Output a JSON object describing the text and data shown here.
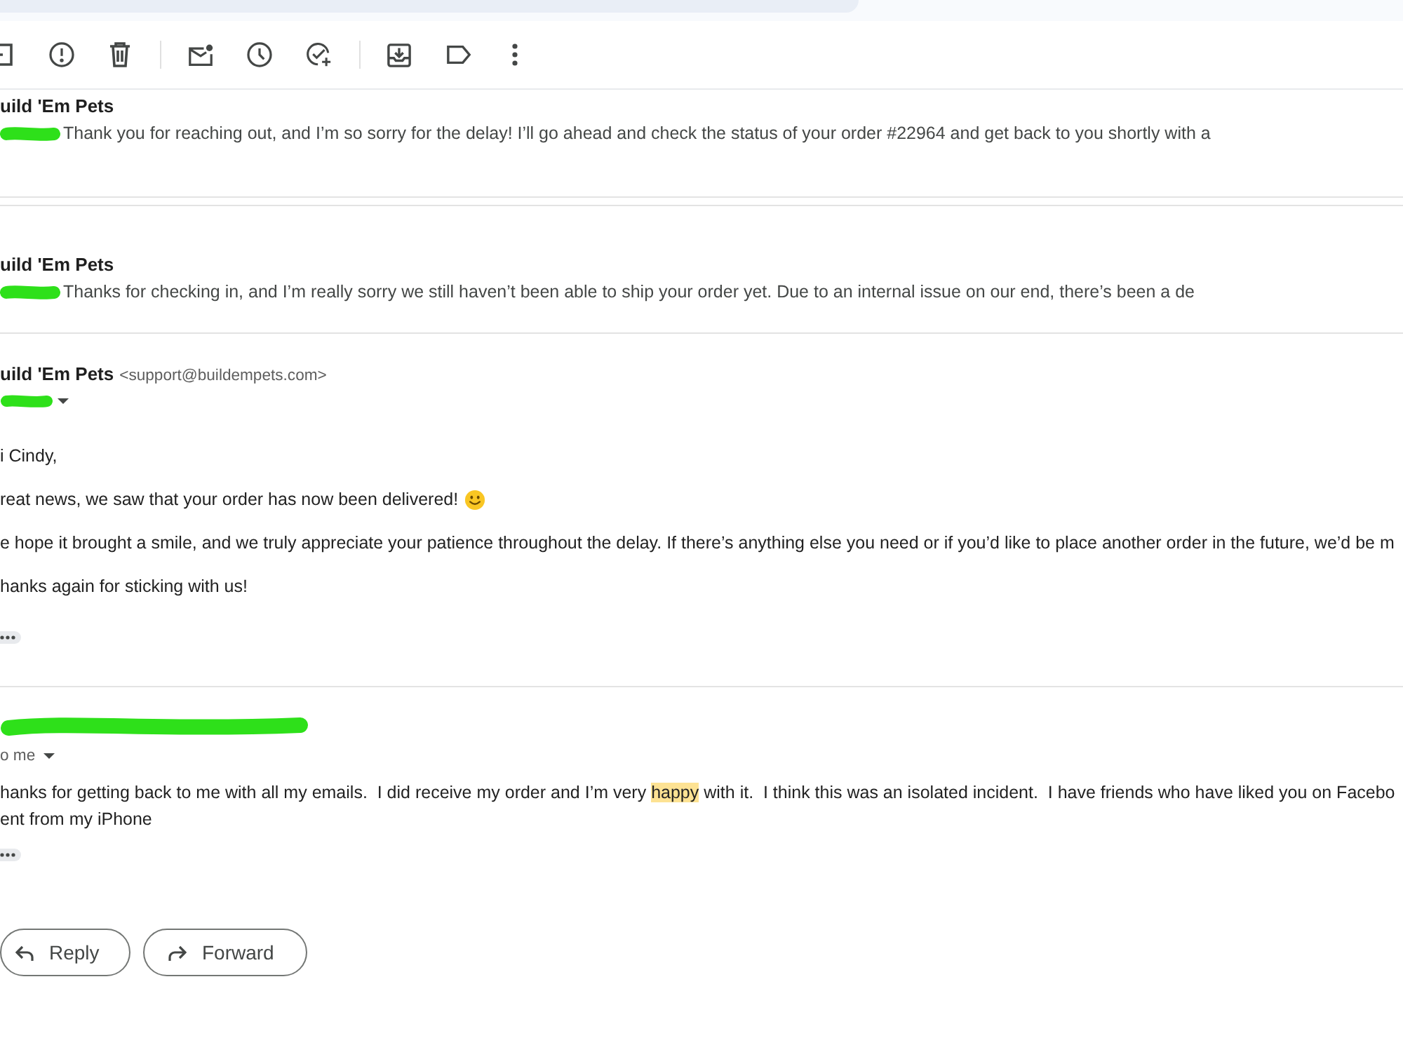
{
  "messages": [
    {
      "kind": "collapsed",
      "sender": "uild 'Em Pets",
      "snippet": "Thank you for reaching out, and I’m so sorry for the delay! I’ll go ahead and check the status of your order #22964 and get back to you shortly with a"
    },
    {
      "kind": "collapsed",
      "sender": "uild 'Em Pets",
      "snippet": "Thanks for checking in, and I’m really sorry we still haven’t been able to ship your order yet. Due to an internal issue on our end, there’s been a de"
    },
    {
      "kind": "expanded",
      "sender": "uild 'Em Pets",
      "email": "<support@buildempets.com>",
      "paragraphs": [
        {
          "segments": [
            {
              "text": "i Cindy,",
              "highlighted": false
            }
          ]
        },
        {
          "segments": [
            {
              "text": "reat news, we saw that your order has now been delivered!",
              "highlighted": false
            }
          ],
          "emoji": true
        },
        {
          "segments": [
            {
              "text": "e hope it brought a smile, and we truly appreciate your patience throughout the delay. If there’s anything else you need or if you’d like to place another order in the future, we’d be m",
              "highlighted": false
            }
          ]
        },
        {
          "segments": [
            {
              "text": "hanks again for sticking with us!",
              "highlighted": false
            }
          ]
        }
      ]
    },
    {
      "kind": "expanded",
      "recipient": "o me",
      "paragraphs": [
        {
          "segments": [
            {
              "text": "hanks for getting back to me with all my emails.  I did receive my order and I’m very ",
              "highlighted": false
            },
            {
              "text": "happy",
              "highlighted": true
            },
            {
              "text": " with it.  I think this was an isolated incident.  I have friends who have liked you on Facebo",
              "highlighted": false
            }
          ]
        },
        {
          "segments": [
            {
              "text": "ent from my iPhone",
              "highlighted": false
            }
          ]
        }
      ]
    }
  ],
  "actions": [
    {
      "kind": "reply",
      "label": "Reply"
    },
    {
      "kind": "forward",
      "label": "Forward"
    }
  ]
}
